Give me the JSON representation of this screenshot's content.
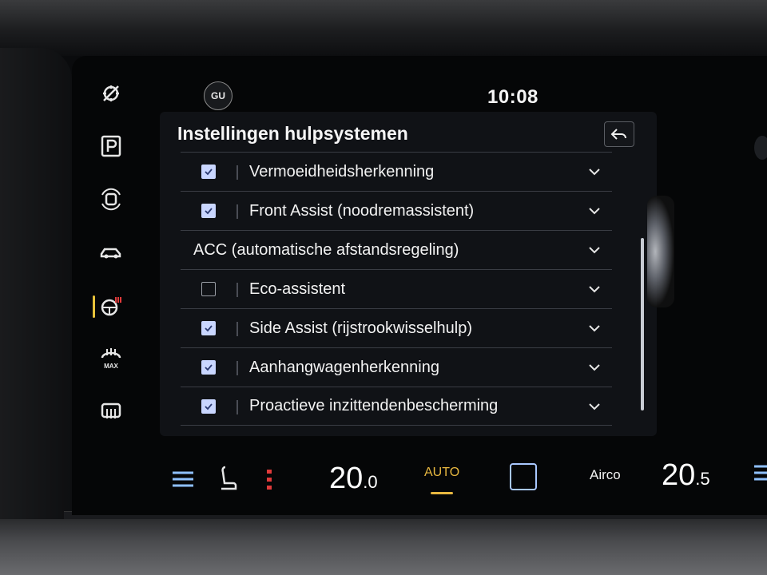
{
  "top_bar": {
    "profile_initials": "GU",
    "clock": "10:08"
  },
  "panel": {
    "title": "Instellingen hulpsystemen",
    "rows": [
      {
        "label": "Vermoeidheidsherkenning",
        "checked": true,
        "group": false
      },
      {
        "label": "Front Assist (noodremassistent)",
        "checked": true,
        "group": false
      },
      {
        "label": "ACC (automatische afstandsregeling)",
        "checked": null,
        "group": true
      },
      {
        "label": "Eco-assistent",
        "checked": false,
        "group": false
      },
      {
        "label": "Side Assist (rijstrookwisselhulp)",
        "checked": true,
        "group": false
      },
      {
        "label": "Aanhangwagenherkenning",
        "checked": true,
        "group": false
      },
      {
        "label": "Proactieve inzittendenbescherming",
        "checked": true,
        "group": false
      }
    ]
  },
  "climate": {
    "temp_left_int": "20",
    "temp_left_dec": ".0",
    "auto_label": "AUTO",
    "airco_label": "Airco",
    "temp_right_int": "20",
    "temp_right_dec": ".5"
  },
  "side_icons": [
    "assist-off-icon",
    "parking-icon",
    "car-sensors-icon",
    "car-view-icon",
    "steering-heat-icon",
    "defrost-max-icon",
    "rear-defrost-icon"
  ],
  "colors": {
    "accent_blue": "#a9c8ff",
    "checkbox_fill": "#c9d6ff",
    "auto_amber": "#e8b840",
    "active_yellow": "#e8c23a",
    "heat_red": "#e03a3a"
  }
}
